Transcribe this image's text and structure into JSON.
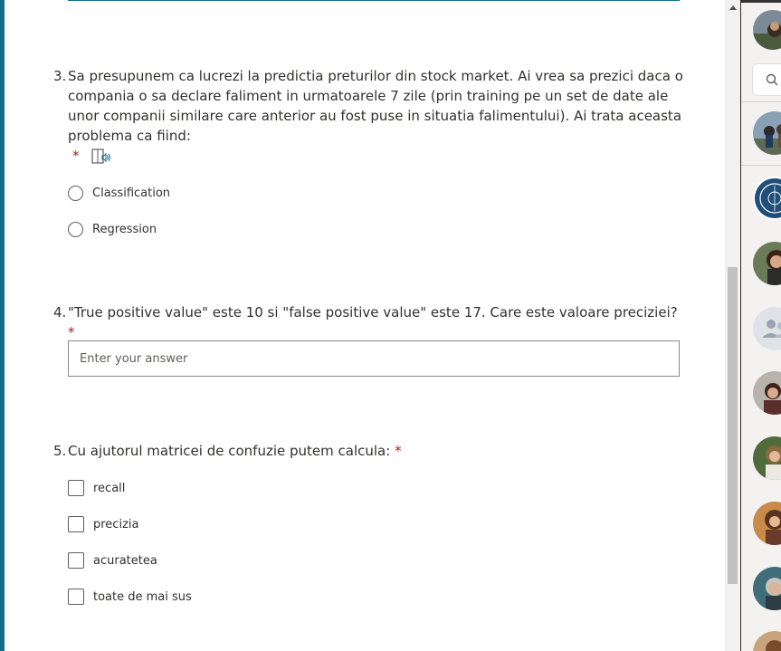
{
  "questions": [
    {
      "number": "3.",
      "text": "Sa presupunem ca lucrezi la predictia preturilor din stock market. Ai vrea sa prezici daca o compania o sa declare faliment in urmatoarele 7 zile (prin training pe un set de date ale unor companii similare care anterior au fost puse in situatia falimentului). Ai trata aceasta problema ca fiind:",
      "required_mark": "*",
      "options": [
        "Classification",
        "Regression"
      ]
    },
    {
      "number": "4.",
      "text": "\"True positive value\" este 10 si \"false positive value\" este 17. Care este valoare preciziei?",
      "required_mark": "*",
      "input_placeholder": "Enter your answer"
    },
    {
      "number": "5.",
      "text": "Cu ajutorul matricei de confuzie putem calcula:",
      "required_mark": "*",
      "options": [
        "recall",
        "precizia",
        "acuratetea",
        "toate de mai sus"
      ]
    }
  ],
  "icons": {
    "immersive_reader": "immersive-reader-icon",
    "search": "search-icon",
    "scroll_up": "scroll-up-arrow-icon"
  },
  "colors": {
    "accent": "#0f6f84",
    "required": "#a4262c",
    "text": "#323130"
  }
}
